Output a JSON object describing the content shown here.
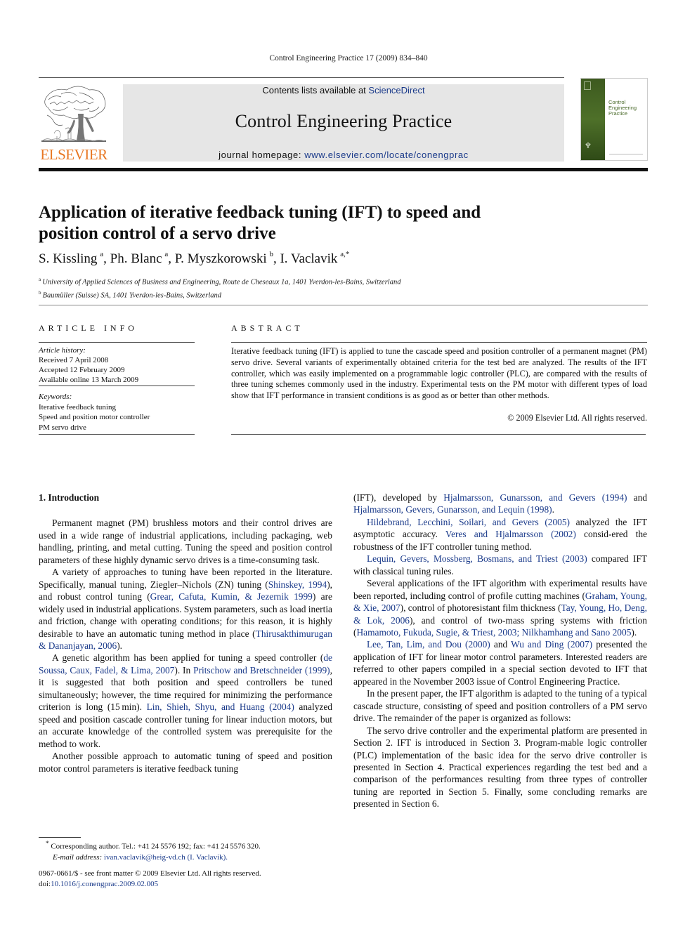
{
  "running_head": "Control Engineering Practice 17 (2009) 834–840",
  "masthead": {
    "contents_prefix": "Contents lists available at ",
    "contents_link": "ScienceDirect",
    "journal_title": "Control Engineering Practice",
    "homepage_prefix": "journal homepage: ",
    "homepage_link": "www.elsevier.com/locate/conengprac",
    "publisher": "ELSEVIER",
    "cover_title": [
      "Control",
      "Engineering",
      "Practice"
    ],
    "colors": {
      "masthead_bg": "#e6e6e6",
      "publisher_orange": "#e87722",
      "link_blue": "#1a3a8a",
      "cover_green": "#4e7029"
    }
  },
  "article": {
    "title": "Application of iterative feedback tuning (IFT) to speed and position control of a servo drive",
    "authors": [
      {
        "name": "S. Kissling",
        "sup": "a"
      },
      {
        "name": "Ph. Blanc",
        "sup": "a"
      },
      {
        "name": "P. Myszkorowski",
        "sup": "b"
      },
      {
        "name": "I. Vaclavik",
        "sup": "a,*"
      }
    ],
    "affiliations": [
      {
        "sup": "a",
        "text": "University of Applied Sciences of Business and Engineering, Route de Cheseaux 1a, 1401 Yverdon-les-Bains, Switzerland"
      },
      {
        "sup": "b",
        "text": "Baumüller (Suisse) SA, 1401 Yverdon-les-Bains, Switzerland"
      }
    ]
  },
  "article_info": {
    "heading": "ARTICLE INFO",
    "history_label": "Article history:",
    "history": [
      "Received 7 April 2008",
      "Accepted 12 February 2009",
      "Available online 13 March 2009"
    ],
    "keywords_label": "Keywords:",
    "keywords": [
      "Iterative feedback tuning",
      "Speed and position motor controller",
      "PM servo drive"
    ]
  },
  "abstract": {
    "heading": "ABSTRACT",
    "text": "Iterative feedback tuning (IFT) is applied to tune the cascade speed and position controller of a permanent magnet (PM) servo drive. Several variants of experimentally obtained criteria for the test bed are analyzed. The results of the IFT controller, which was easily implemented on a programmable logic controller (PLC), are compared with the results of three tuning schemes commonly used in the industry. Experimental tests on the PM motor with different types of load show that IFT performance in transient conditions is as good as or better than other methods.",
    "copyright": "© 2009 Elsevier Ltd. All rights reserved."
  },
  "introduction": {
    "heading": "1.  Introduction",
    "left": {
      "p1": "Permanent magnet (PM) brushless motors and their control drives are used in a wide range of industrial applications, including packaging, web handling, printing, and metal cutting. Tuning the speed and position control parameters of these highly dynamic servo drives is a time-consuming task.",
      "p2": {
        "t1": "A variety of approaches to tuning have been reported in the literature. Specifically, manual tuning, Ziegler–Nichols (ZN) tuning (",
        "r1": "Shinskey, 1994",
        "t2": "), and robust control tuning (",
        "r2": "Grear, Cafuta, Kumin, & Jezernik 1999",
        "t3": ") are widely used in industrial applications. System parameters, such as load inertia and friction, change with operating conditions; for this reason, it is highly desirable to have an automatic tuning method in place (",
        "r3": "Thirusakthimurugan & Dananjayan, 2006",
        "t4": ")."
      },
      "p3": {
        "t1": "A genetic algorithm has been applied for tuning a speed controller (",
        "r1": "de Soussa, Caux, Fadel, & Lima, 2007",
        "t2": "). In ",
        "r2": "Pritschow and Bretschneider (1999)",
        "t3": ", it is suggested that both position and speed controllers be tuned simultaneously; however, the time required for minimizing the performance criterion is long (15 min). ",
        "r3": "Lin, Shieh, Shyu, and Huang (2004)",
        "t4": " analyzed speed and position cascade controller tuning for linear induction motors, but an accurate knowledge of the controlled system was prerequisite for the method to work."
      },
      "p4": "Another possible approach to automatic tuning of speed and position motor control parameters is iterative feedback tuning"
    },
    "right": {
      "p1": {
        "t1": "(IFT), developed by ",
        "r1": "Hjalmarsson, Gunarsson, and Gevers (1994)",
        "t2": " and ",
        "r2": "Hjalmarsson, Gevers, Gunarsson, and Lequin (1998)",
        "t3": "."
      },
      "p2": {
        "r1": "Hildebrand, Lecchini, Soilari, and Gevers (2005)",
        "t1": " analyzed the IFT asymptotic accuracy. ",
        "r2": "Veres and Hjalmarsson (2002)",
        "t2": " consid-ered the robustness of the IFT controller tuning method."
      },
      "p3": {
        "r1": "Lequin, Gevers, Mossberg, Bosmans, and Triest (2003)",
        "t1": " compared IFT with classical tuning rules."
      },
      "p4": {
        "t1": "Several applications of the IFT algorithm with experimental results have been reported, including control of profile cutting machines (",
        "r1": "Graham, Young, & Xie, 2007",
        "t2": "), control of photoresistant film thickness (",
        "r2": "Tay, Young, Ho, Deng, & Lok, 2006",
        "t3": "), and control of two-mass spring systems with friction (",
        "r3": "Hamamoto, Fukuda, Sugie, & Triest, 2003; Nilkhamhang and Sano 2005",
        "t4": ")."
      },
      "p5": {
        "r1": "Lee, Tan, Lim, and Dou (2000)",
        "t1": " and ",
        "r2": "Wu and Ding (2007)",
        "t2": " presented the application of IFT for linear motor control parameters. Interested readers are referred to other papers compiled in a special section devoted to IFT that appeared in the November 2003 issue of Control Engineering Practice."
      },
      "p6": "In the present paper, the IFT algorithm is adapted to the tuning of a typical cascade structure, consisting of speed and position controllers of a PM servo drive. The remainder of the paper is organized as follows:",
      "p7": "The servo drive controller and the experimental platform are presented in Section 2. IFT is introduced in Section 3. Program-mable logic controller (PLC) implementation of the basic idea for the servo drive controller is presented in Section 4. Practical experiences regarding the test bed and a comparison of the performances resulting from three types of controller tuning are reported in Section 5. Finally, some concluding remarks are presented in Section 6."
    }
  },
  "footnote": {
    "star": "*",
    "corresponding": " Corresponding author. Tel.: +41 24 5576 192; fax: +41 24 5576 320.",
    "email_label": "E-mail address:",
    "email": "ivan.vaclavik@heig-vd.ch (I. Vaclavik)."
  },
  "front_matter": {
    "issn_line": "0967-0661/$ - see front matter © 2009 Elsevier Ltd. All rights reserved.",
    "doi_label": "doi:",
    "doi": "10.1016/j.conengprac.2009.02.005"
  }
}
